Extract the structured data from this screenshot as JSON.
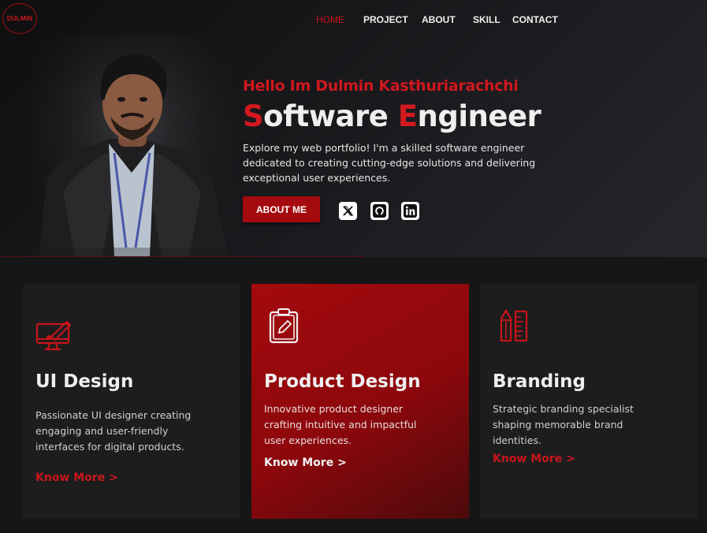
{
  "logo": {
    "text": "DULMIN"
  },
  "nav": {
    "items": [
      {
        "label": "HOME",
        "active": true
      },
      {
        "label": "PROJECT",
        "active": false
      },
      {
        "label": "ABOUT",
        "active": false
      },
      {
        "label": "SKILL",
        "active": false
      },
      {
        "label": "CONTACT",
        "active": false
      }
    ]
  },
  "hero": {
    "greeting": "Hello Im Dulmin Kasthuriarachchi",
    "title_first_initial": "S",
    "title_first_rest": "oftware ",
    "title_second_initial": "E",
    "title_second_rest": "ngineer",
    "description": "Explore my web portfolio! I'm a skilled software engineer dedicated to creating cutting-edge solutions and delivering exceptional user experiences.",
    "about_button": "ABOUT ME",
    "socials": [
      "x-icon",
      "github-icon",
      "linkedin-icon"
    ]
  },
  "cards": [
    {
      "icon": "monitor-brush-icon",
      "title": "UI Design",
      "text": "Passionate UI designer creating engaging and user-friendly interfaces for digital products.",
      "link": "Know More  >"
    },
    {
      "icon": "clipboard-pen-icon",
      "title": "Product Design",
      "text": "Innovative product designer crafting intuitive and impactful user experiences.",
      "link": "Know More  >"
    },
    {
      "icon": "pencil-ruler-icon",
      "title": "Branding",
      "text": "Strategic branding specialist shaping memorable brand identities.",
      "link": "Know More  >"
    }
  ],
  "colors": {
    "accent": "#c9141a",
    "card_red": "#a30a0e",
    "background": "#161616"
  }
}
